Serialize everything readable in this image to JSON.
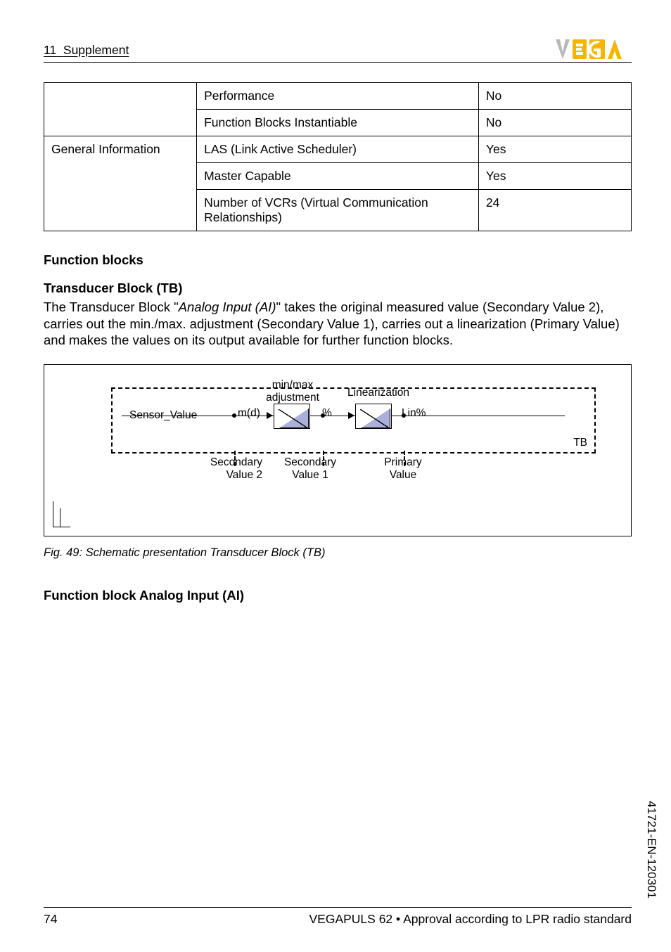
{
  "header": {
    "section_number": "11",
    "section_title": "Supplement",
    "logo_text_1": "V",
    "logo_text_2": "E",
    "logo_text_3": "G",
    "logo_text_4": "A"
  },
  "table": {
    "rows": [
      {
        "c2": "Performance",
        "c3": "No"
      },
      {
        "c2": "Function Blocks Instantiable",
        "c3": "No"
      },
      {
        "c1": "General Information",
        "c2": "LAS (Link Active Scheduler)",
        "c3": "Yes"
      },
      {
        "c2": "Master Capable",
        "c3": "Yes"
      },
      {
        "c2": "Number of VCRs (Virtual Communication Relationships)",
        "c3": "24"
      }
    ]
  },
  "headings": {
    "function_blocks": "Function blocks",
    "tb_heading": "Transducer Block (TB)",
    "ai_heading": "Function block Analog Input (AI)"
  },
  "tb_para_pre": "The Transducer Block \"",
  "tb_para_ital": "Analog Input (AI)",
  "tb_para_post": "\" takes the original measured value (Secondary Value 2), carries out the min./max. adjustment (Secondary Value 1), carries out a linearization (Primary Value) and makes the values on its output available for further function blocks.",
  "diagram": {
    "sensor_value": "Sensor_Value",
    "md": "m(d)",
    "minmax": "min/max\nadjustment",
    "pct": "%",
    "linearization": "Linearization",
    "linpct": "Lin%",
    "tb": "TB",
    "sv2": "Secondary\nValue 2",
    "sv1": "Secondary\nValue 1",
    "pv": "Primary\nValue"
  },
  "fig_caption": "Fig. 49: Schematic presentation Transducer Block (TB)",
  "side_doc_id": "41721-EN-120301",
  "footer": {
    "page": "74",
    "product": "VEGAPULS 62",
    "bullet": "•",
    "approval": "Approval according to LPR radio standard"
  }
}
